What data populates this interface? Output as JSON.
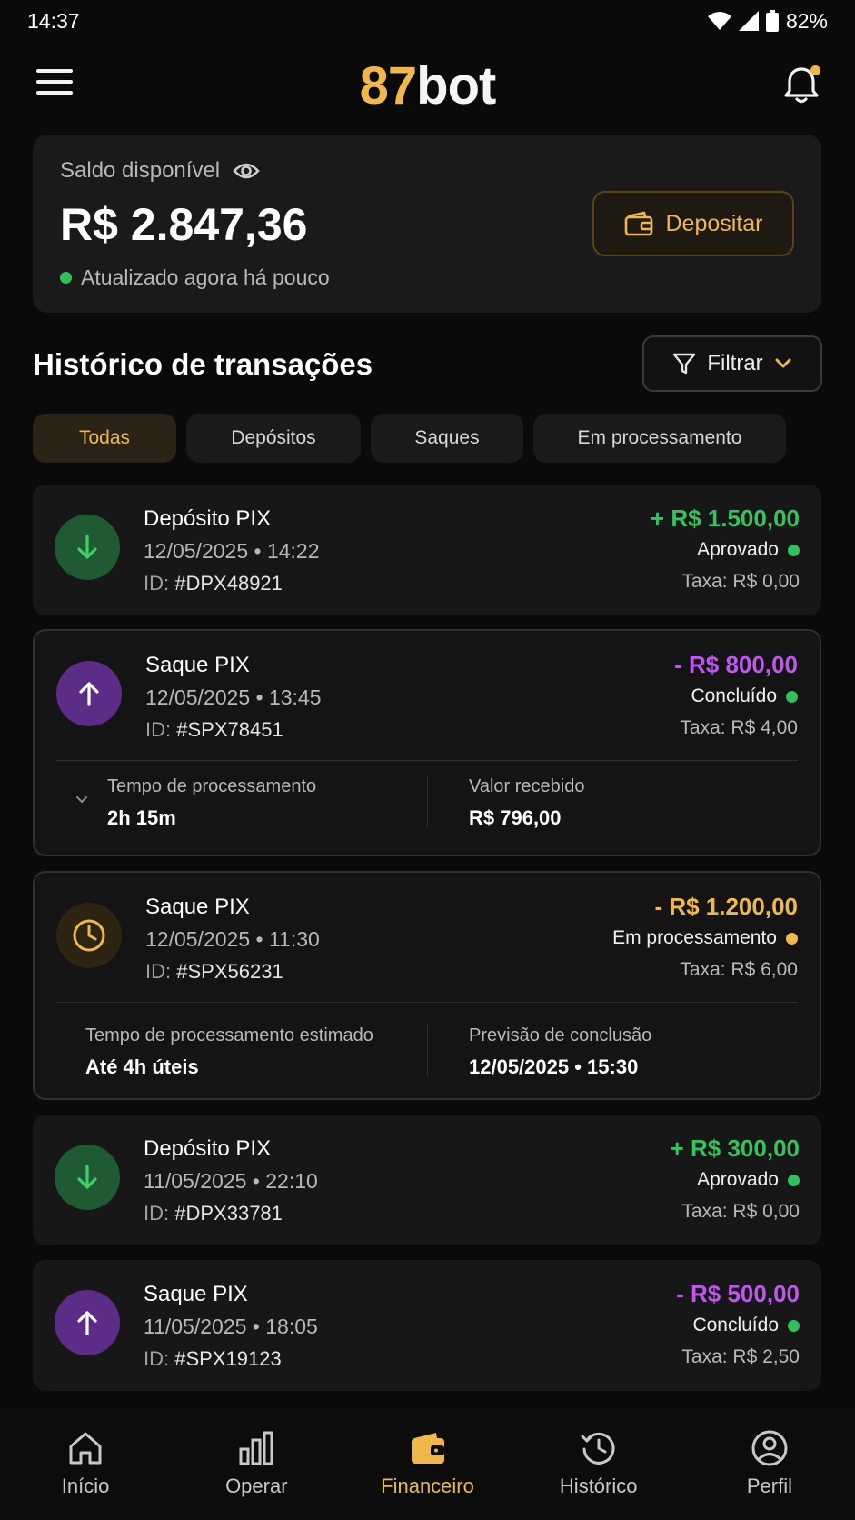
{
  "status_bar": {
    "time": "14:37",
    "battery": "82%"
  },
  "header": {
    "logo_num": "87",
    "logo_word": "bot"
  },
  "balance": {
    "label": "Saldo disponível",
    "value": "R$ 2.847,36",
    "updated": "Atualizado agora há pouco",
    "deposit_label": "Depositar"
  },
  "history": {
    "title": "Histórico de transações",
    "filter_label": "Filtrar",
    "tabs": [
      {
        "label": "Todas",
        "active": true
      },
      {
        "label": "Depósitos",
        "active": false
      },
      {
        "label": "Saques",
        "active": false
      },
      {
        "label": "Em processamento",
        "active": false
      }
    ]
  },
  "transactions": [
    {
      "title": "Depósito PIX",
      "date": "12/05/2025 • 14:22",
      "id_label": "ID:",
      "id": "#DPX48921",
      "amount": "+ R$ 1.500,00",
      "status": "Aprovado",
      "fee": "Taxa: R$ 0,00",
      "kind": "deposit"
    },
    {
      "title": "Saque PIX",
      "date": "12/05/2025 • 13:45",
      "id_label": "ID:",
      "id": "#SPX78451",
      "amount": "- R$ 800,00",
      "status": "Concluído",
      "fee": "Taxa: R$ 4,00",
      "kind": "withdraw",
      "details": [
        {
          "label": "Tempo de processamento",
          "value": "2h 15m"
        },
        {
          "label": "Valor recebido",
          "value": "R$ 796,00"
        }
      ]
    },
    {
      "title": "Saque PIX",
      "date": "12/05/2025 • 11:30",
      "id_label": "ID:",
      "id": "#SPX56231",
      "amount": "- R$ 1.200,00",
      "status": "Em processamento",
      "fee": "Taxa: R$ 6,00",
      "kind": "pending",
      "details": [
        {
          "label": "Tempo de processamento estimado",
          "value": "Até 4h úteis"
        },
        {
          "label": "Previsão de conclusão",
          "value": "12/05/2025 • 15:30"
        }
      ]
    },
    {
      "title": "Depósito PIX",
      "date": "11/05/2025 • 22:10",
      "id_label": "ID:",
      "id": "#DPX33781",
      "amount": "+ R$ 300,00",
      "status": "Aprovado",
      "fee": "Taxa: R$ 0,00",
      "kind": "deposit"
    },
    {
      "title": "Saque PIX",
      "date": "11/05/2025 • 18:05",
      "id_label": "ID:",
      "id": "#SPX19123",
      "amount": "- R$ 500,00",
      "status": "Concluído",
      "fee": "Taxa: R$ 2,50",
      "kind": "withdraw"
    }
  ],
  "nav": [
    {
      "label": "Início",
      "icon": "home-icon"
    },
    {
      "label": "Operar",
      "icon": "bar-chart-icon"
    },
    {
      "label": "Financeiro",
      "icon": "wallet-icon",
      "active": true
    },
    {
      "label": "Histórico",
      "icon": "history-icon"
    },
    {
      "label": "Perfil",
      "icon": "profile-icon"
    }
  ],
  "colors": {
    "accent": "#f0b84a",
    "positive": "#34c35e",
    "withdraw": "#c055f0",
    "background": "#0a0a0a",
    "card": "#1a1a1a"
  }
}
